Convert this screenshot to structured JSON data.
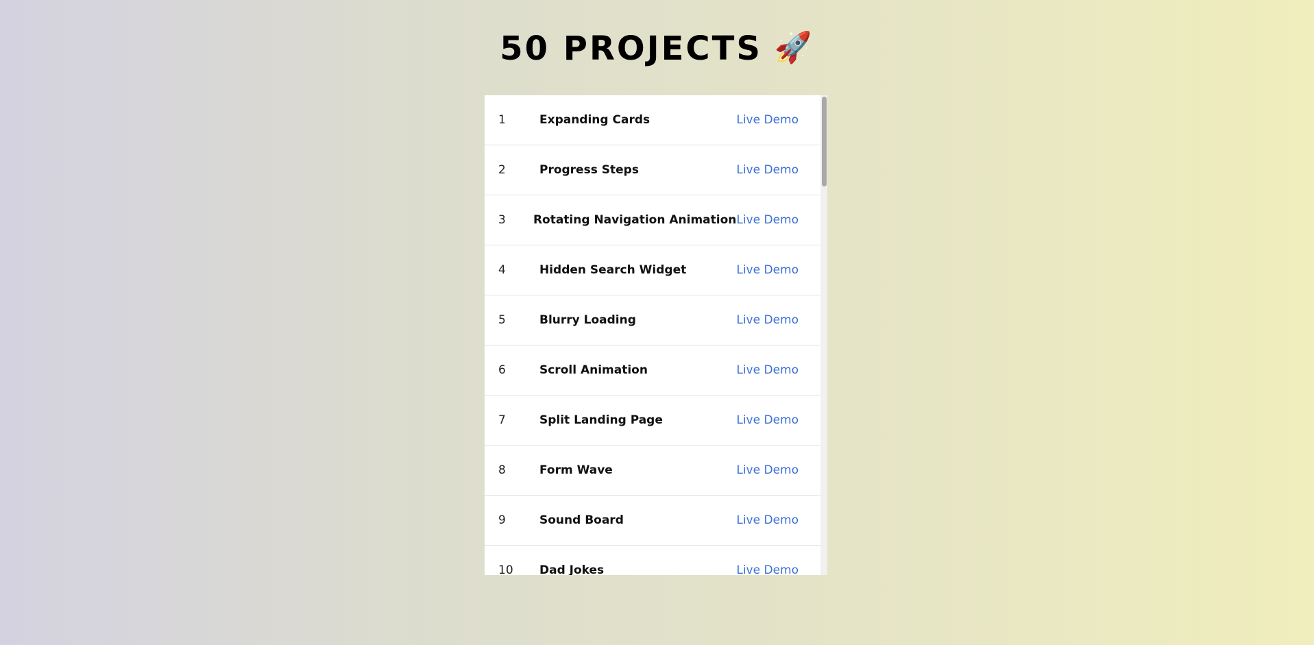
{
  "header": {
    "title": "50 PROJECTS",
    "icon": "rocket-icon",
    "icon_glyph": "🚀"
  },
  "projects": [
    {
      "num": "1",
      "name": "Expanding Cards",
      "link_label": "Live Demo"
    },
    {
      "num": "2",
      "name": "Progress Steps",
      "link_label": "Live Demo"
    },
    {
      "num": "3",
      "name": "Rotating Navigation Animation",
      "link_label": "Live Demo"
    },
    {
      "num": "4",
      "name": "Hidden Search Widget",
      "link_label": "Live Demo"
    },
    {
      "num": "5",
      "name": "Blurry Loading",
      "link_label": "Live Demo"
    },
    {
      "num": "6",
      "name": "Scroll Animation",
      "link_label": "Live Demo"
    },
    {
      "num": "7",
      "name": "Split Landing Page",
      "link_label": "Live Demo"
    },
    {
      "num": "8",
      "name": "Form Wave",
      "link_label": "Live Demo"
    },
    {
      "num": "9",
      "name": "Sound Board",
      "link_label": "Live Demo"
    },
    {
      "num": "10",
      "name": "Dad Jokes",
      "link_label": "Live Demo"
    }
  ],
  "colors": {
    "link": "#3a6fd8",
    "background_start": "#d4d2e0",
    "background_end": "#f0eebc"
  }
}
